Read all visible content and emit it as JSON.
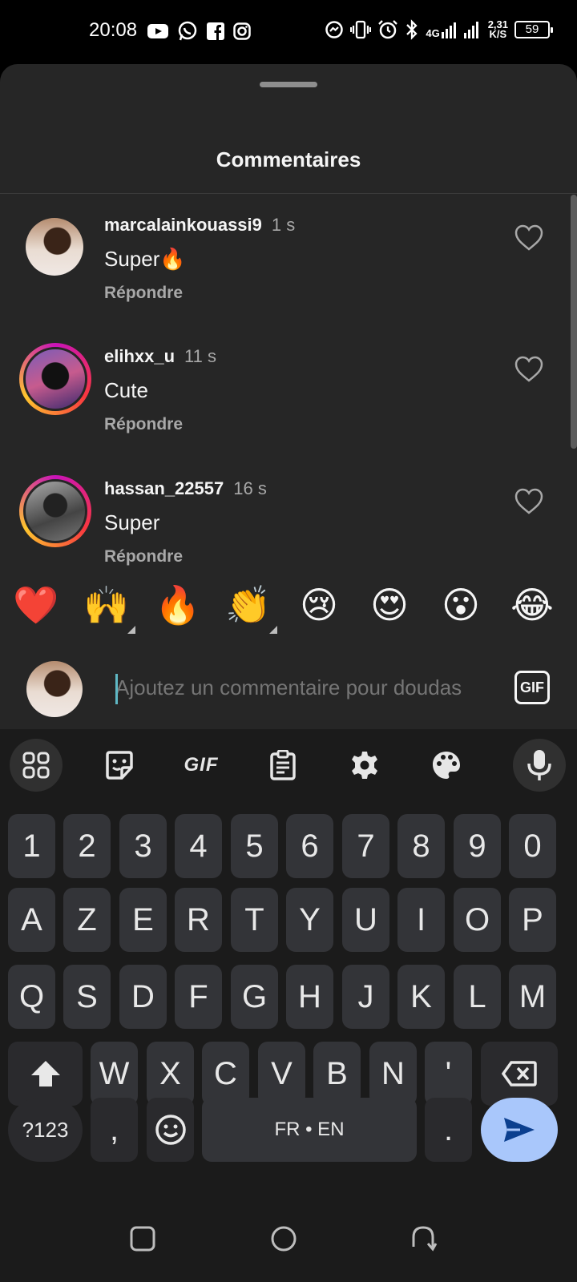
{
  "status_bar": {
    "time": "20:08",
    "left_icons": [
      "youtube-icon",
      "whatsapp-icon",
      "facebook-icon",
      "instagram-icon"
    ],
    "right_icons": [
      "messenger-icon",
      "vibrate-icon",
      "alarm-icon",
      "bluetooth-icon",
      "signal-4g-icon",
      "signal-icon"
    ],
    "network_type": "4G",
    "data_rate": "2,31",
    "data_unit": "K/S",
    "battery": "59"
  },
  "sheet": {
    "title": "Commentaires"
  },
  "comments": [
    {
      "username": "marcalainkouassi9",
      "time": "1 s",
      "text": "Super🔥",
      "reply": "Répondre",
      "ring": false
    },
    {
      "username": "elihxx_u",
      "time": "11 s",
      "text": "Cute",
      "reply": "Répondre",
      "ring": true
    },
    {
      "username": "hassan_22557",
      "time": "16 s",
      "text": "Super",
      "reply": "Répondre",
      "ring": true
    }
  ],
  "emoji_bar": [
    "❤️",
    "🙌",
    "🔥",
    "👏",
    "😢",
    "😍",
    "😮",
    "😂"
  ],
  "input": {
    "placeholder": "Ajoutez un commentaire pour doudas",
    "gif_label": "GIF"
  },
  "keyboard": {
    "toolbar": [
      "apps-icon",
      "sticker-icon",
      "GIF",
      "clipboard-icon",
      "settings-icon",
      "palette-icon",
      "microphone-icon"
    ],
    "toolbar_gif": "GIF",
    "row_numbers": [
      "1",
      "2",
      "3",
      "4",
      "5",
      "6",
      "7",
      "8",
      "9",
      "0"
    ],
    "row1": [
      "A",
      "Z",
      "E",
      "R",
      "T",
      "Y",
      "U",
      "I",
      "O",
      "P"
    ],
    "row2": [
      "Q",
      "S",
      "D",
      "F",
      "G",
      "H",
      "J",
      "K",
      "L",
      "M"
    ],
    "row3": [
      "W",
      "X",
      "C",
      "V",
      "B",
      "N",
      "'"
    ],
    "symbols_key": "?123",
    "comma_key": ",",
    "space_label": "FR • EN",
    "period_key": ".",
    "accent_color": "#a9c7fb"
  },
  "nav_bar": [
    "recents-icon",
    "home-icon",
    "back-icon"
  ]
}
